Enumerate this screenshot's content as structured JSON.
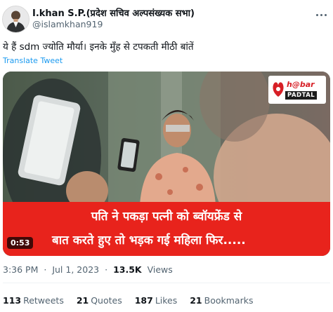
{
  "author": {
    "display_name": "I.khan S.P.(प्रदेश सचिव अल्पसंख्यक सभा)",
    "handle": "@islamkhan919",
    "avatar_icon": "profile-photo-avatar"
  },
  "tweet": {
    "text": "ये हैं sdm ज्योति मौर्या। इनके मुँह से टपकती मीठी बांतें",
    "translate_label": "Translate Tweet"
  },
  "media": {
    "type": "video",
    "duration": "0:53",
    "logo_top": "h@bar",
    "logo_bottom": "PADTAL",
    "caption_line1": "पति ने पकड़ा पत्नी को ब्वॉयफ्रेंड से",
    "caption_line2": "बात करते हुए तो भड़क गई महिला फिर.....",
    "banner_color": "#e8231c"
  },
  "meta": {
    "time": "3:36 PM",
    "separator": "·",
    "date": "Jul 1, 2023",
    "views_count": "13.5K",
    "views_label": "Views"
  },
  "stats": [
    {
      "count": "113",
      "label": "Retweets"
    },
    {
      "count": "21",
      "label": "Quotes"
    },
    {
      "count": "187",
      "label": "Likes"
    },
    {
      "count": "21",
      "label": "Bookmarks"
    }
  ],
  "colors": {
    "link": "#1d9bf0",
    "muted": "#536471",
    "text": "#0f1419"
  }
}
